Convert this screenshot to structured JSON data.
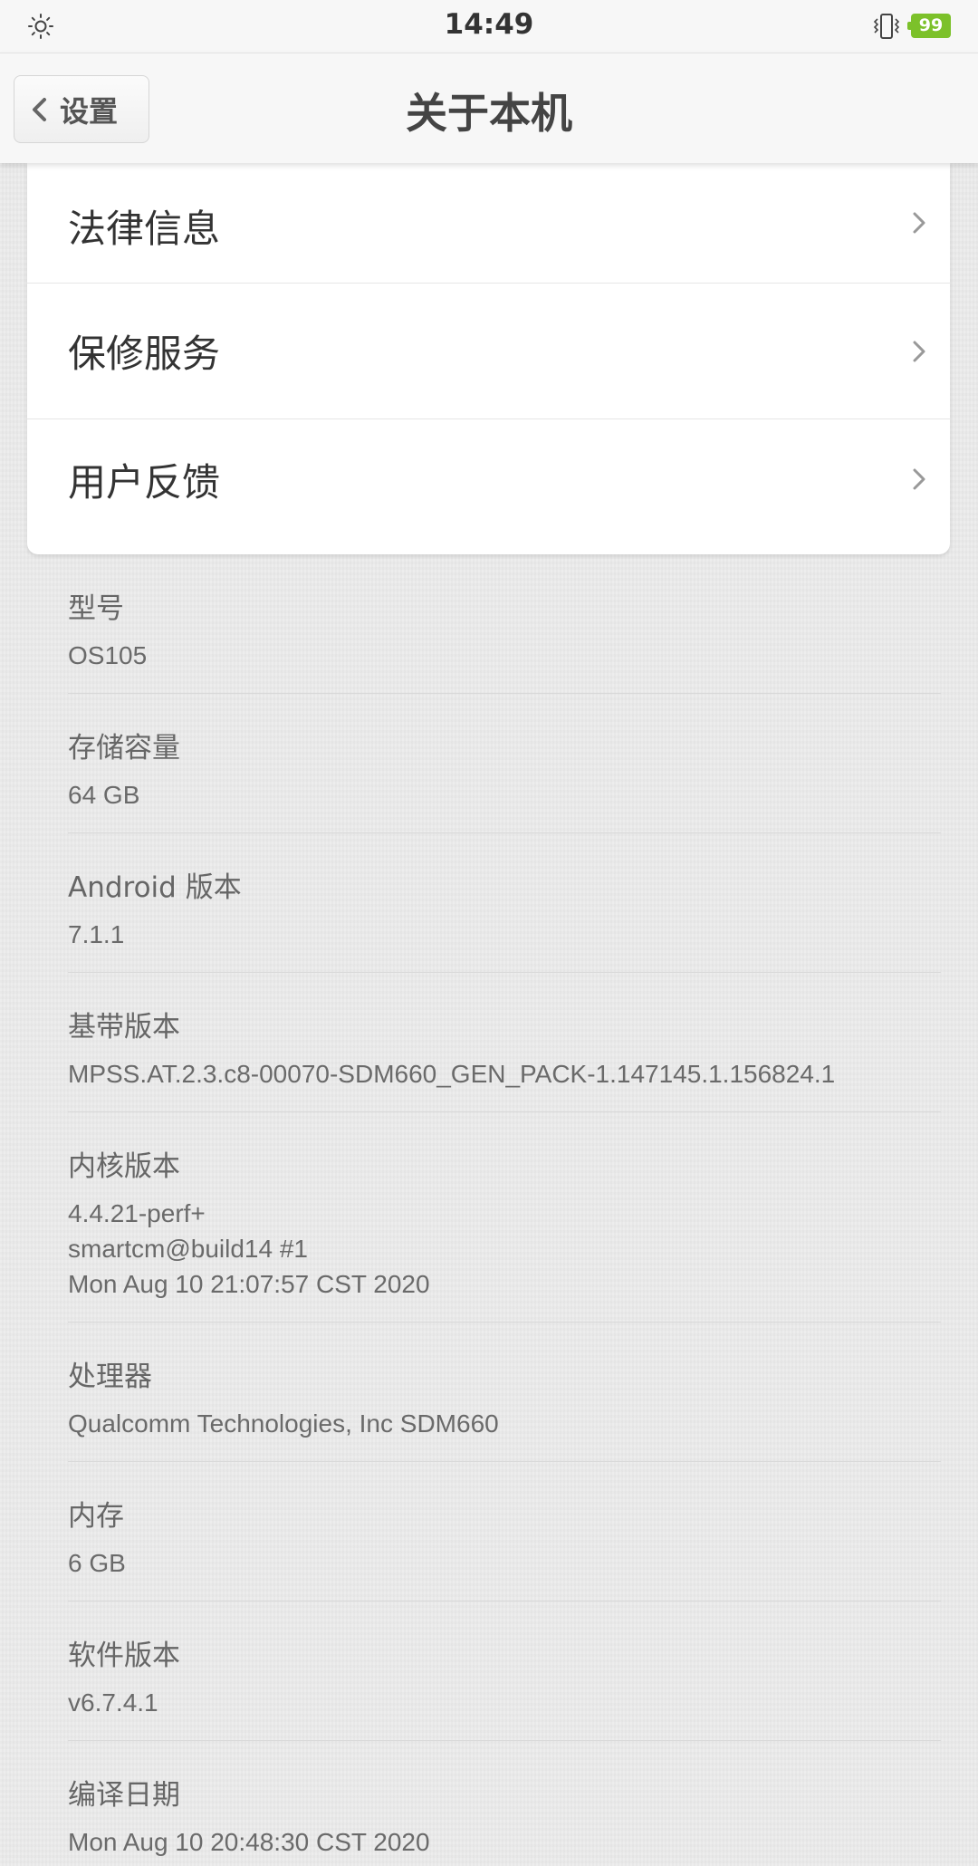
{
  "status_bar": {
    "time": "14:49",
    "battery": "99",
    "icons": [
      "brightness-icon",
      "vibrate-icon",
      "battery-icon"
    ],
    "battery_color": "#7cc12a"
  },
  "header": {
    "back_label": "设置",
    "title": "关于本机"
  },
  "menu": {
    "items": [
      {
        "label": "法律信息"
      },
      {
        "label": "保修服务"
      },
      {
        "label": "用户反馈"
      }
    ]
  },
  "info": {
    "items": [
      {
        "label": "型号",
        "value": "OS105"
      },
      {
        "label": "存储容量",
        "value": "64 GB"
      },
      {
        "label": "Android 版本",
        "value": "7.1.1"
      },
      {
        "label": "基带版本",
        "value": "MPSS.AT.2.3.c8-00070-SDM660_GEN_PACK-1.147145.1.156824.1"
      },
      {
        "label": "内核版本",
        "value": "4.4.21-perf+\nsmartcm@build14 #1\nMon Aug 10 21:07:57 CST 2020"
      },
      {
        "label": "处理器",
        "value": "Qualcomm Technologies, Inc SDM660"
      },
      {
        "label": "内存",
        "value": "6 GB"
      },
      {
        "label": "软件版本",
        "value": "v6.7.4.1"
      },
      {
        "label": "编译日期",
        "value": "Mon Aug 10 20:48:30 CST 2020"
      }
    ]
  }
}
